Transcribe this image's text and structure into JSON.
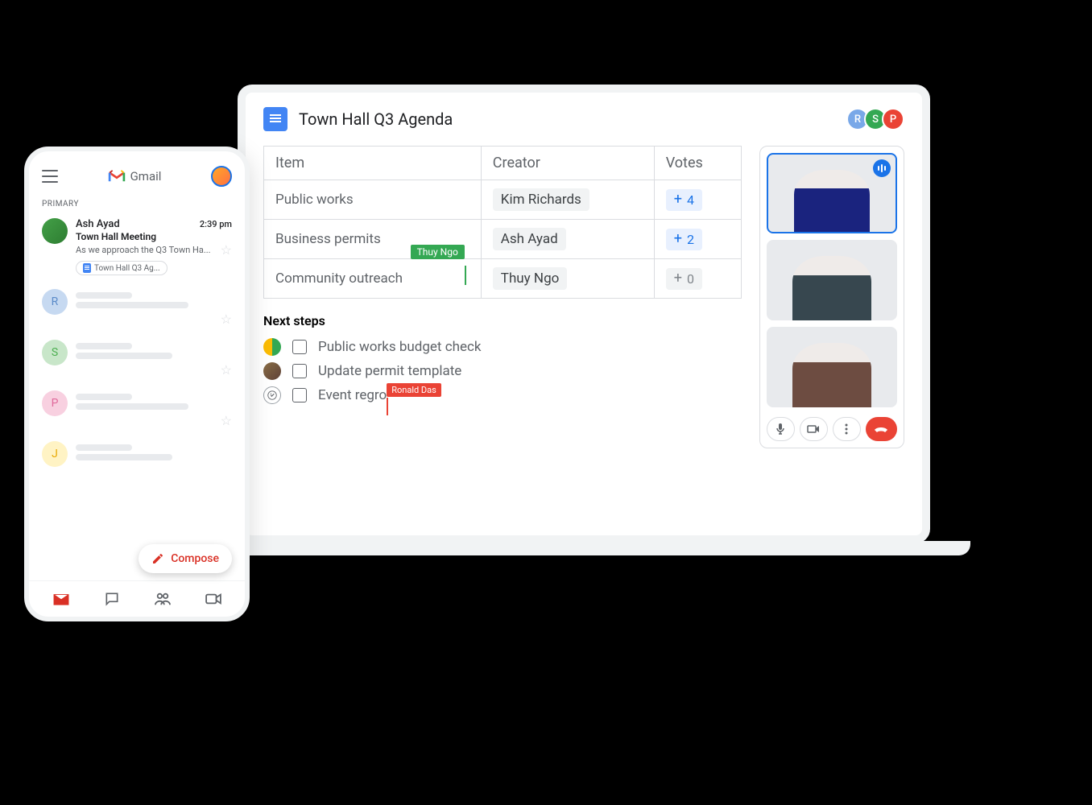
{
  "gmail": {
    "app_name": "Gmail",
    "primary_label": "PRIMARY",
    "compose_label": "Compose",
    "email": {
      "sender": "Ash Ayad",
      "time": "2:39 pm",
      "subject": "Town Hall Meeting",
      "snippet": "As we approach the Q3 Town Ha...",
      "attachment": "Town Hall Q3 Ag..."
    },
    "placeholder_initials": {
      "r": "R",
      "s": "S",
      "p": "P",
      "j": "J"
    }
  },
  "doc": {
    "title": "Town Hall Q3 Agenda",
    "collaborators": [
      {
        "initial": "R",
        "class": "r"
      },
      {
        "initial": "S",
        "class": "s"
      },
      {
        "initial": "P",
        "class": "p"
      }
    ],
    "table": {
      "headers": {
        "item": "Item",
        "creator": "Creator",
        "votes": "Votes"
      },
      "rows": [
        {
          "item": "Public works",
          "creator": "Kim Richards",
          "votes": "4",
          "grey": false
        },
        {
          "item": "Business permits",
          "creator": "Ash Ayad",
          "votes": "2",
          "grey": false
        },
        {
          "item": "Community outreach",
          "creator": "Thuy Ngo",
          "votes": "0",
          "grey": true,
          "cursor": "Thuy Ngo"
        }
      ]
    },
    "next_steps": {
      "title": "Next steps",
      "items": [
        {
          "text": "Public works budget check"
        },
        {
          "text": "Update permit template"
        },
        {
          "text": "Event regro",
          "cursor": "Ronald Das"
        }
      ]
    }
  },
  "meet": {
    "participant_count": 3
  }
}
